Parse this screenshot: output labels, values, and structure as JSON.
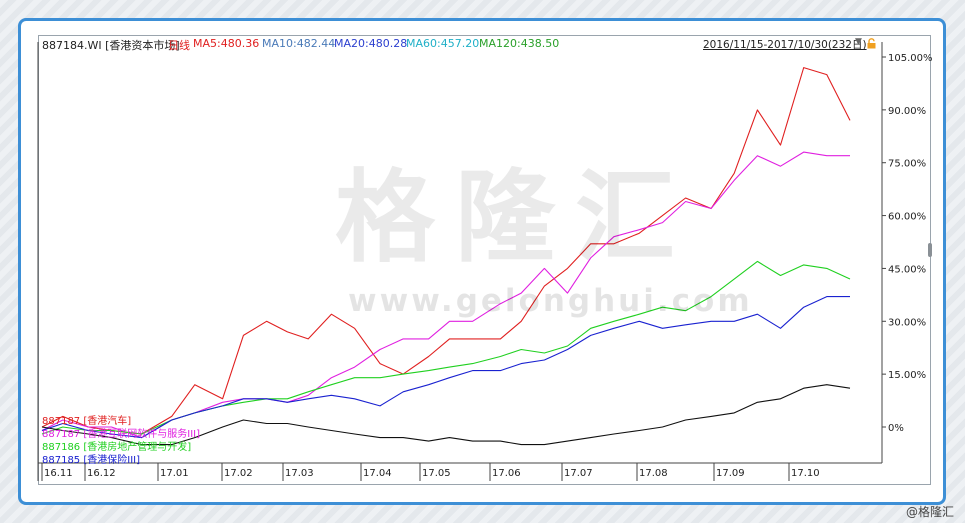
{
  "header": {
    "code_label": "887184.WI [香港资本市场]",
    "period": "日线",
    "ma": [
      {
        "text": "MA5:480.36",
        "color": "#e02020"
      },
      {
        "text": "MA10:482.44",
        "color": "#4a7ab8"
      },
      {
        "text": "MA20:480.28",
        "color": "#2c3fcf"
      },
      {
        "text": "MA60:457.20",
        "color": "#20b0c8"
      },
      {
        "text": "MA120:438.50",
        "color": "#2aa02a"
      }
    ],
    "date_range": "2016/11/15-2017/10/30(232日)"
  },
  "watermark": {
    "brand": "格隆汇",
    "url": "www.gelonghui.com",
    "corner": "@格隆汇"
  },
  "chart_data": {
    "type": "line",
    "x_ticks": [
      "16.11",
      "16.12",
      "17.01",
      "17.02",
      "17.03",
      "17.04",
      "17.05",
      "17.06",
      "17.07",
      "17.08",
      "17.09",
      "17.10"
    ],
    "y_ticks": [
      "105.00%",
      "90.00%",
      "75.00%",
      "60.00%",
      "45.00%",
      "30.00%",
      "15.00%",
      "0%"
    ],
    "ylim": [
      -10,
      105
    ],
    "grid": false,
    "legend": "bottom-left",
    "x": [
      "2016-11-15",
      "2016-11-24",
      "2016-12-05",
      "2016-12-15",
      "2016-12-28",
      "2017-01-10",
      "2017-01-20",
      "2017-02-01",
      "2017-02-10",
      "2017-02-20",
      "2017-03-01",
      "2017-03-10",
      "2017-03-20",
      "2017-03-30",
      "2017-04-10",
      "2017-04-20",
      "2017-05-01",
      "2017-05-10",
      "2017-05-20",
      "2017-06-01",
      "2017-06-10",
      "2017-06-20",
      "2017-06-30",
      "2017-07-10",
      "2017-07-20",
      "2017-07-31",
      "2017-08-10",
      "2017-08-20",
      "2017-08-31",
      "2017-09-10",
      "2017-09-20",
      "2017-09-30",
      "2017-10-10",
      "2017-10-20",
      "2017-10-30"
    ],
    "series": [
      {
        "name": "887187 [香港汽车]",
        "color": "#e02020",
        "values": [
          0,
          3,
          0,
          -1,
          -2,
          3,
          12,
          8,
          26,
          30,
          27,
          25,
          32,
          28,
          18,
          15,
          20,
          25,
          25,
          25,
          30,
          40,
          45,
          52,
          52,
          55,
          60,
          65,
          62,
          72,
          90,
          80,
          102,
          100,
          87
        ]
      },
      {
        "name": "887187 [香港互联网软件与服务III]",
        "color": "#e020e0",
        "values": [
          -1,
          2,
          0,
          0,
          -3,
          2,
          4,
          7,
          8,
          8,
          7,
          9,
          14,
          17,
          22,
          25,
          25,
          30,
          30,
          35,
          38,
          45,
          38,
          48,
          54,
          56,
          58,
          64,
          62,
          70,
          77,
          74,
          78,
          77,
          77
        ]
      },
      {
        "name": "887186 [香港房地产管理与开发]",
        "color": "#20d020",
        "values": [
          -2,
          0,
          -1,
          -1,
          -2,
          2,
          4,
          6,
          7,
          8,
          8,
          10,
          12,
          14,
          14,
          15,
          16,
          17,
          18,
          20,
          22,
          21,
          23,
          28,
          30,
          32,
          34,
          33,
          37,
          42,
          47,
          43,
          46,
          45,
          42
        ]
      },
      {
        "name": "887185 [香港保险III]",
        "color": "#1a22d0",
        "values": [
          -1,
          1,
          -1,
          -2,
          -3,
          2,
          4,
          6,
          8,
          8,
          7,
          8,
          9,
          8,
          6,
          10,
          12,
          14,
          16,
          16,
          18,
          19,
          22,
          26,
          28,
          30,
          28,
          29,
          30,
          30,
          32,
          28,
          34,
          37,
          37
        ]
      },
      {
        "name": "",
        "color": "#101010",
        "values": [
          0,
          -1,
          -2,
          -3,
          -5,
          -5,
          -3,
          0,
          2,
          1,
          1,
          0,
          -1,
          -2,
          -3,
          -3,
          -4,
          -3,
          -4,
          -4,
          -5,
          -5,
          -4,
          -3,
          -2,
          -1,
          0,
          2,
          3,
          4,
          7,
          8,
          11,
          12,
          11
        ]
      }
    ]
  }
}
